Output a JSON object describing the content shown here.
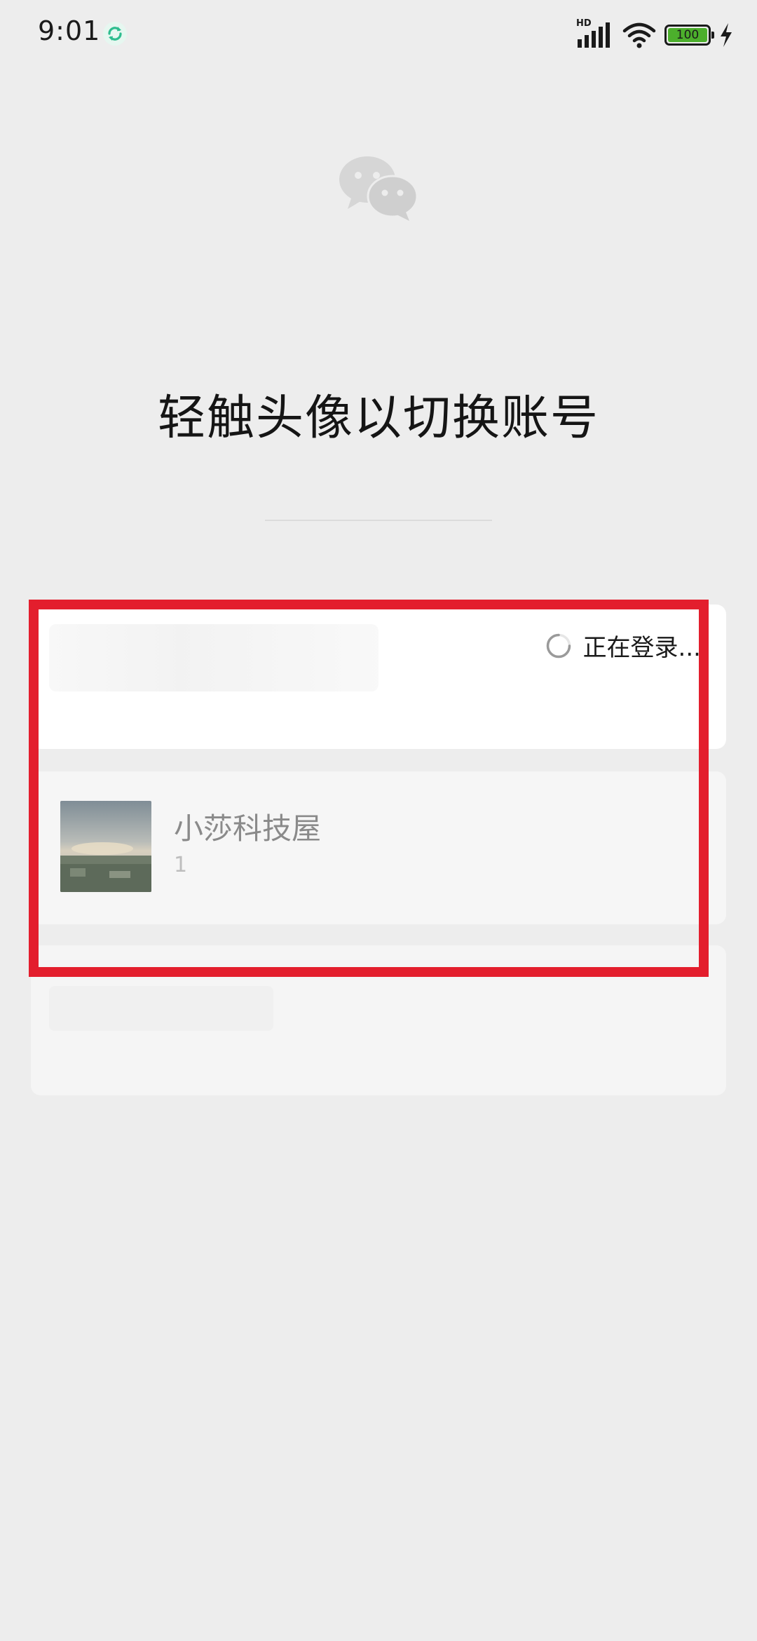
{
  "status_bar": {
    "time": "9:01",
    "network_label": "HD",
    "battery_level": "100",
    "icons": [
      "sync-app-icon",
      "signal-icon",
      "wifi-icon",
      "battery-icon",
      "charging-icon"
    ]
  },
  "logo": {
    "icon": "wechat-logo-icon"
  },
  "title": "轻触头像以切换账号",
  "accounts": [
    {
      "status_text": "正在登录..."
    },
    {
      "name": "小莎科技屋",
      "id": "1"
    },
    {}
  ],
  "colors": {
    "background": "#ededed",
    "card": "#ffffff",
    "highlight": "#e31e2d",
    "sync_icon": "#2ebd8f"
  }
}
